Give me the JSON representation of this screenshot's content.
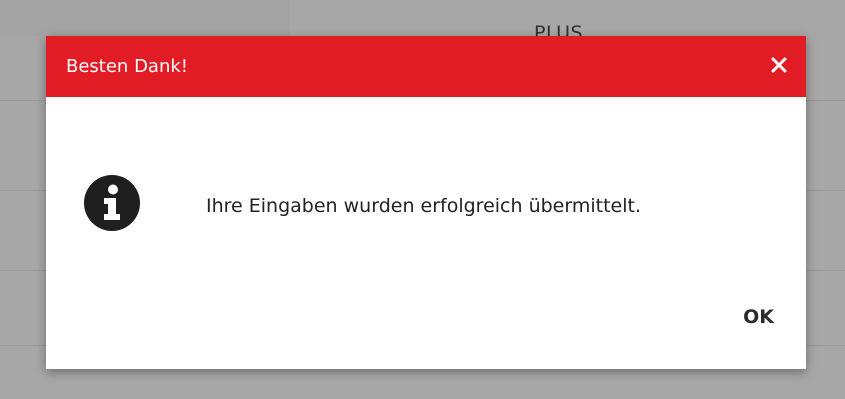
{
  "background": {
    "header_text": "PLUS"
  },
  "dialog": {
    "title": "Besten Dank!",
    "close_icon": "close-icon",
    "info_icon": "info-circle-icon",
    "message": "Ihre Eingaben wurden erfolgreich übermittelt.",
    "ok_label": "OK"
  },
  "colors": {
    "header_red": "#e21c25",
    "overlay": "rgba(0,0,0,0.32)",
    "icon_dark": "#1f1f1f"
  }
}
